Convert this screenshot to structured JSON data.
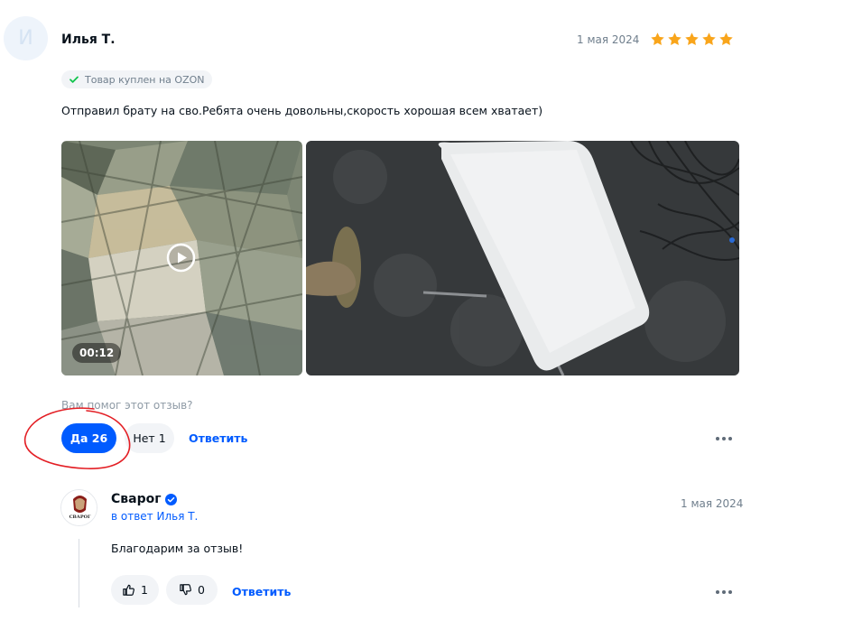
{
  "review": {
    "avatar_letter": "И",
    "author": "Илья Т.",
    "date": "1 мая 2024",
    "rating": 5,
    "star_color": "#f9a51b",
    "purchase_badge": "Товар куплен на OZON",
    "text": "Отправил брату на сво.Ребята очень довольны,скорость хорошая всем хватает)",
    "video_duration": "00:12",
    "helpful_question": "Вам помог этот отзыв?",
    "yes_label": "Да 26",
    "no_label": "Нет 1",
    "reply_label": "Ответить"
  },
  "seller_reply": {
    "name": "Сварог",
    "logo_text": "СВАРОГ",
    "in_reply_to": "в ответ Илья Т.",
    "date": "1 мая 2024",
    "text": "Благодарим за отзыв!",
    "likes": "1",
    "dislikes": "0",
    "reply_label": "Ответить"
  },
  "colors": {
    "accent": "#005bff",
    "annotation": "#e31e24"
  },
  "icons": [
    "star-icon",
    "check-icon",
    "play-icon",
    "verified-icon",
    "thumb-up-icon",
    "thumb-down-icon",
    "more-icon"
  ]
}
